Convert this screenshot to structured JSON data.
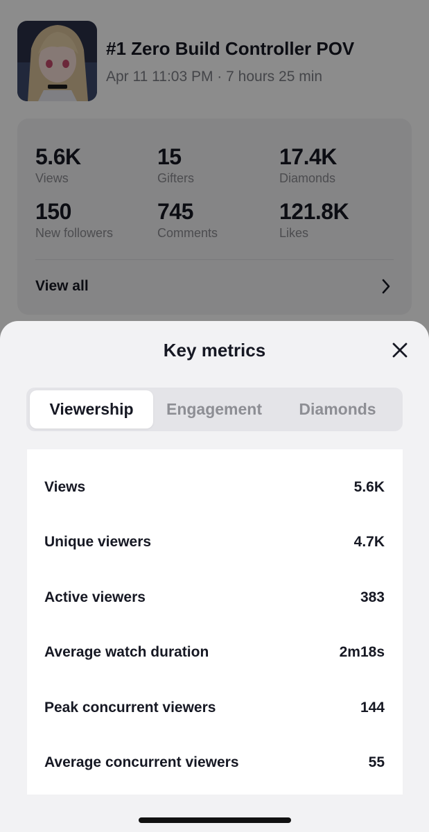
{
  "stream": {
    "title": "#1 Zero Build Controller POV",
    "meta": "Apr 11 11:03 PM · 7 hours 25 min"
  },
  "summary": {
    "stats": [
      {
        "value": "5.6K",
        "label": "Views"
      },
      {
        "value": "15",
        "label": "Gifters"
      },
      {
        "value": "17.4K",
        "label": "Diamonds"
      },
      {
        "value": "150",
        "label": "New followers"
      },
      {
        "value": "745",
        "label": "Comments"
      },
      {
        "value": "121.8K",
        "label": "Likes"
      }
    ],
    "view_all": "View all"
  },
  "sheet": {
    "title": "Key metrics",
    "tabs": [
      {
        "label": "Viewership",
        "active": true
      },
      {
        "label": "Engagement",
        "active": false
      },
      {
        "label": "Diamonds",
        "active": false
      }
    ],
    "metrics": [
      {
        "label": "Views",
        "value": "5.6K"
      },
      {
        "label": "Unique viewers",
        "value": "4.7K"
      },
      {
        "label": "Active viewers",
        "value": "383"
      },
      {
        "label": "Average watch duration",
        "value": "2m18s"
      },
      {
        "label": "Peak concurrent viewers",
        "value": "144"
      },
      {
        "label": "Average concurrent viewers",
        "value": "55"
      }
    ]
  },
  "icons": {
    "close": "close-icon",
    "chevron": "chevron-right-icon"
  }
}
